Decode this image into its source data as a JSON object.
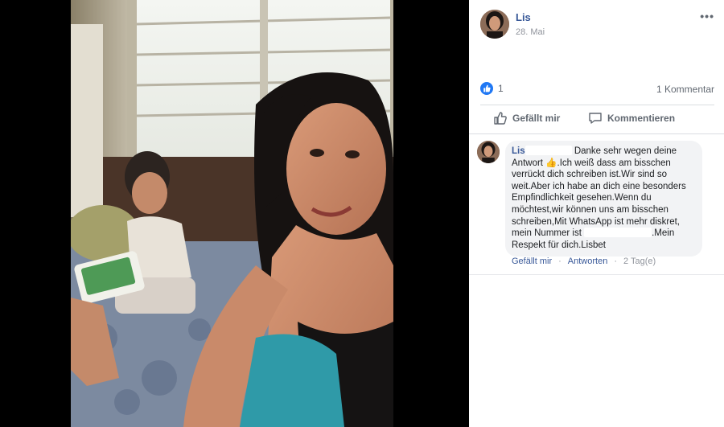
{
  "post": {
    "author": "Lis",
    "date": "28. Mai",
    "more_menu": "•••",
    "reaction_count": "1",
    "comment_count": "1 Kommentar",
    "like_label": "Gefällt mir",
    "comment_label": "Kommentieren"
  },
  "comment": {
    "author": "Lis",
    "text_part1": "Danke sehr wegen deine Antwort ",
    "emoji": "👍",
    "text_part2": ".Ich weiß dass am bisschen verrückt dich schreiben ist.Wir sind so weit.Aber ich habe an dich eine besonders Empfindlichkeit gesehen.Wenn du möchtest,wir können uns am bisschen schreiben,Mit WhatsApp ist mehr diskret, mein Nummer ist ",
    "text_part3": ".Mein Respekt für dich.Lisbet",
    "like_label": "Gefällt mir",
    "reply_label": "Antworten",
    "time": "2 Tag(e)"
  },
  "colors": {
    "link_blue": "#385898",
    "like_blue": "#2078f4",
    "muted": "#606770"
  }
}
